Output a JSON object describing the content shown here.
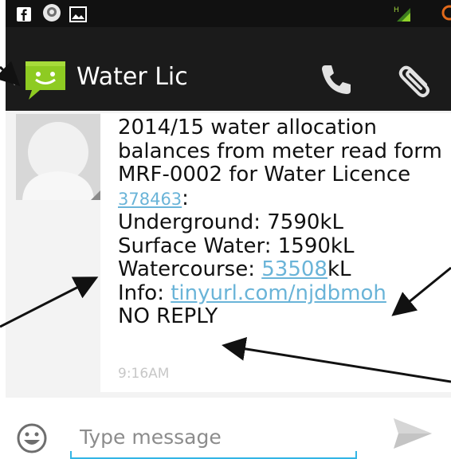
{
  "app": {
    "contact_name": "Water Lic",
    "back_glyph": "‹",
    "logo_icon": "sms-app-logo-icon"
  },
  "status_bar": {
    "left_icons": [
      "facebook-icon",
      "messenger-icon",
      "gallery-icon"
    ],
    "right_icons": [
      "signal-h-icon",
      "sync-icon"
    ]
  },
  "action_bar": {
    "actions": [
      "phone-icon",
      "paperclip-icon"
    ]
  },
  "message": {
    "line1": "2014/15 water allocation",
    "line2": "balances from meter read form",
    "line3": "MRF-0002 for Water Licence",
    "licence_number": "378463",
    "licence_suffix": ":",
    "underground": "Underground: 7590kL",
    "surface_water": "Surface Water: 1590kL",
    "watercourse_label": "Watercourse: ",
    "watercourse_value": "53508",
    "watercourse_unit": "kL",
    "info_label": "Info: ",
    "info_url": "tinyurl.com/njdbmoh",
    "no_reply": "NO REPLY",
    "time": "9:16AM"
  },
  "compose": {
    "placeholder": "Type message",
    "emoji_icon": "smiley-icon",
    "send_icon": "send-icon"
  },
  "colors": {
    "status_bar": "#111111",
    "action_bar": "#1b1b1b",
    "logo_green": "#8ecb22",
    "link": "#6ab4d8",
    "input_accent": "#33b5e5",
    "timestamp": "#c7c7c7"
  }
}
